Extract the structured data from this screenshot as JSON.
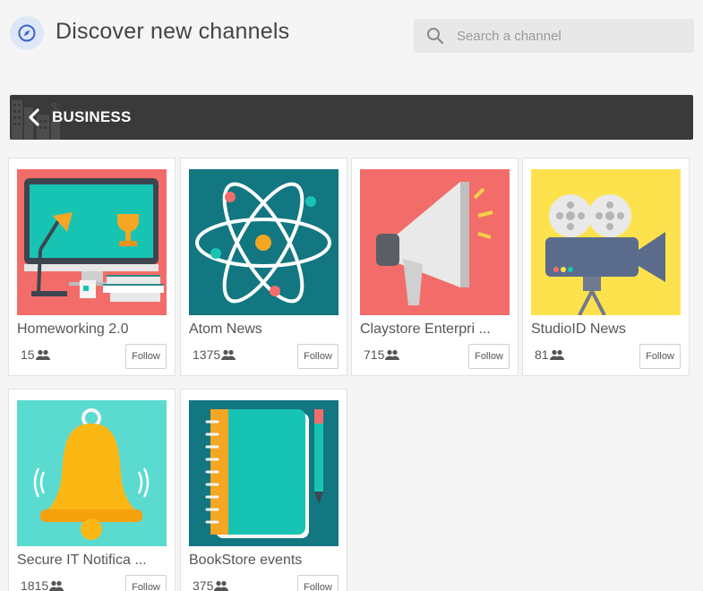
{
  "header": {
    "title": "Discover new channels",
    "search_placeholder": "Search a channel"
  },
  "category": {
    "label": "BUSINESS"
  },
  "channels": [
    {
      "name": "Homeworking 2.0",
      "followers": "15",
      "follow_label": "Follow",
      "icon": "desk-lamp-trophy-illustration",
      "bg": "#f26d6a"
    },
    {
      "name": "Atom News",
      "followers": "1375",
      "follow_label": "Follow",
      "icon": "atom-illustration",
      "bg": "#127781"
    },
    {
      "name": "Claystore Enterpri ...",
      "followers": "715",
      "follow_label": "Follow",
      "icon": "megaphone-illustration",
      "bg": "#f26d6a"
    },
    {
      "name": "StudioID News",
      "followers": "81",
      "follow_label": "Follow",
      "icon": "movie-camera-illustration",
      "bg": "#fde24e"
    },
    {
      "name": "Secure IT Notifica ...",
      "followers": "1815",
      "follow_label": "Follow",
      "icon": "bell-illustration",
      "bg": "#5bdad0"
    },
    {
      "name": "BookStore events",
      "followers": "375",
      "follow_label": "Follow",
      "icon": "notebook-pen-illustration",
      "bg": "#127781"
    }
  ],
  "colors": {
    "background": "#f5f5f5",
    "category_bar": "#3a3a3a",
    "compass_bg": "#dde7f6",
    "compass_accent": "#3d63c9"
  }
}
